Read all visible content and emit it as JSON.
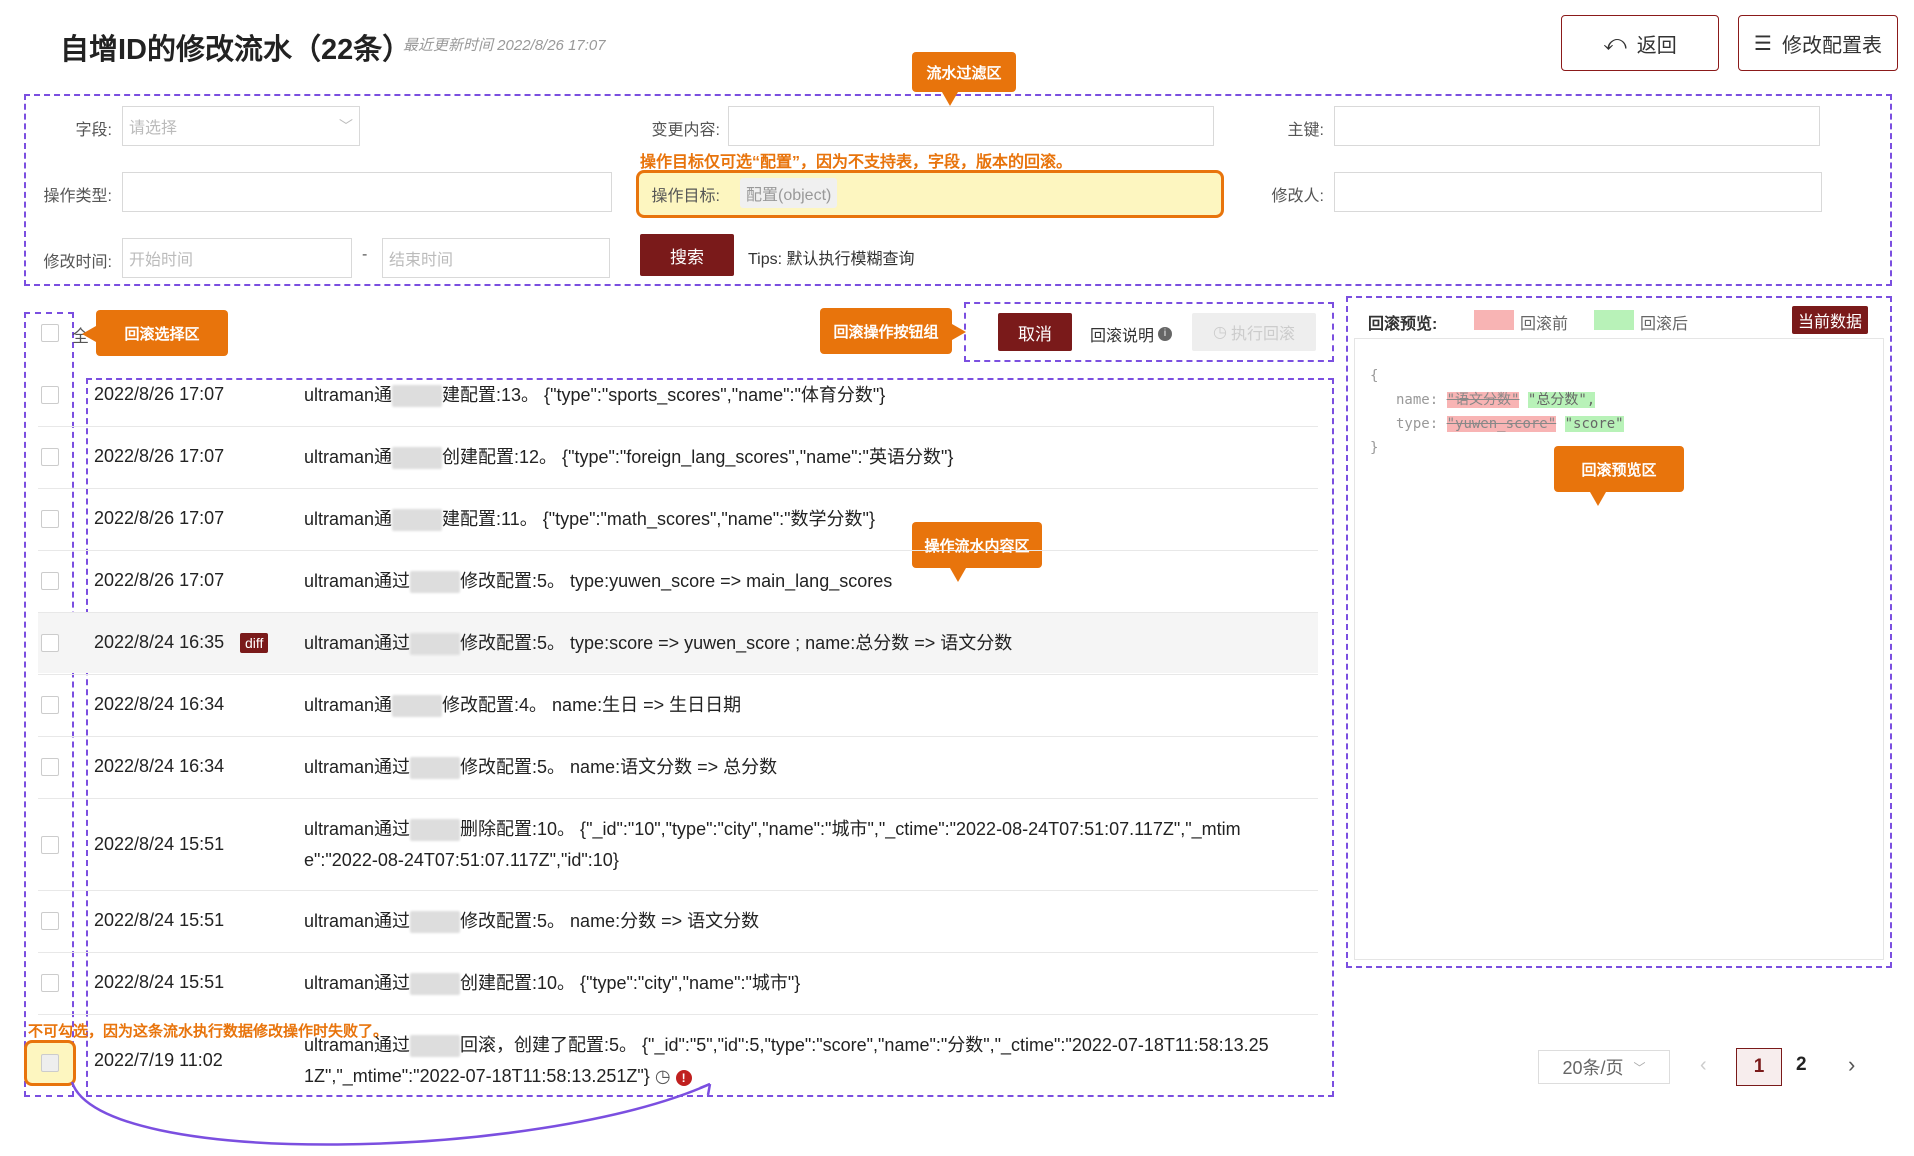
{
  "header": {
    "title": "自增ID的修改流水（22条）",
    "updated": "最近更新时间 2022/8/26 17:07",
    "back_label": "返回",
    "edit_label": "修改配置表"
  },
  "callouts": {
    "filter": "流水过滤区",
    "rollback_select": "回滚选择区",
    "rollback_buttons": "回滚操作按钮组",
    "flow_content": "操作流水内容区",
    "preview": "回滚预览区"
  },
  "filter": {
    "field_label": "字段:",
    "field_placeholder": "请选择",
    "change_label": "变更内容:",
    "key_label": "主键:",
    "optype_label": "操作类型:",
    "target_note": "操作目标仅可选“配置”，因为不支持表，字段，版本的回滚。",
    "target_label": "操作目标:",
    "target_value": "配置(object)",
    "modifier_label": "修改人:",
    "time_label": "修改时间:",
    "start_placeholder": "开始时间",
    "separator": "-",
    "end_placeholder": "结束时间",
    "search_label": "搜索",
    "tips": "Tips: 默认执行模糊查询"
  },
  "actions": {
    "select_all": "全",
    "cancel": "取消",
    "explain": "回滚说明",
    "execute": "执行回滚"
  },
  "rows": [
    {
      "time": "2022/8/26 17:07",
      "pre": "ultraman通",
      "post": "建配置:13。 {\"type\":\"sports_scores\",\"name\":\"体育分数\"}"
    },
    {
      "time": "2022/8/26 17:07",
      "pre": "ultraman通",
      "post": "创建配置:12。 {\"type\":\"foreign_lang_scores\",\"name\":\"英语分数\"}"
    },
    {
      "time": "2022/8/26 17:07",
      "pre": "ultraman通",
      "post": "建配置:11。 {\"type\":\"math_scores\",\"name\":\"数学分数\"}"
    },
    {
      "time": "2022/8/26 17:07",
      "pre": "ultraman通过",
      "post": "修改配置:5。 type:yuwen_score => main_lang_scores"
    },
    {
      "time": "2022/8/24 16:35",
      "pre": "ultraman通过",
      "post": "修改配置:5。 type:score => yuwen_score ; name:总分数 => 语文分数",
      "badge": "diff"
    },
    {
      "time": "2022/8/24 16:34",
      "pre": "ultraman通",
      "post": "修改配置:4。 name:生日 => 生日日期"
    },
    {
      "time": "2022/8/24 16:34",
      "pre": "ultraman通过",
      "post": "修改配置:5。 name:语文分数 => 总分数"
    },
    {
      "time": "2022/8/24 15:51",
      "pre": "ultraman通过",
      "post": "删除配置:10。 {\"_id\":\"10\",\"type\":\"city\",\"name\":\"城市\",\"_ctime\":\"2022-08-24T07:51:07.117Z\",\"_mtim",
      "line2": "e\":\"2022-08-24T07:51:07.117Z\",\"id\":10}"
    },
    {
      "time": "2022/8/24 15:51",
      "pre": "ultraman通过",
      "post": "修改配置:5。 name:分数 => 语文分数"
    },
    {
      "time": "2022/8/24 15:51",
      "pre": "ultraman通过",
      "post": "创建配置:10。 {\"type\":\"city\",\"name\":\"城市\"}"
    },
    {
      "time": "2022/7/19 11:02",
      "pre": "ultraman通过",
      "post": "回滚，创建了配置:5。 {\"_id\":\"5\",\"id\":5,\"type\":\"score\",\"name\":\"分数\",\"_ctime\":\"2022-07-18T11:58:13.25",
      "line2": "1Z\",\"_mtime\":\"2022-07-18T11:58:13.251Z\"}"
    }
  ],
  "disabled_note": "不可勾选，因为这条流水执行数据修改操作时失败了。",
  "preview": {
    "title": "回滚预览:",
    "before": "回滚前",
    "after": "回滚后",
    "current": "当前数据",
    "open": "{",
    "close": "}",
    "name_key": "name:",
    "name_old": "\"语文分数\"",
    "name_new": "\"总分数\",",
    "type_key": "type:",
    "type_old": "\"yuwen_score\"",
    "type_new": "\"score\""
  },
  "pagination": {
    "page_size": "20条/页",
    "pages": [
      "1",
      "2"
    ],
    "current": "1"
  },
  "colors": {
    "brand": "#7a1a1a",
    "accent_orange": "#e8740c",
    "dash_purple": "#7b4fe0",
    "before_bg": "#f8b4b4",
    "after_bg": "#b8f2b8"
  }
}
